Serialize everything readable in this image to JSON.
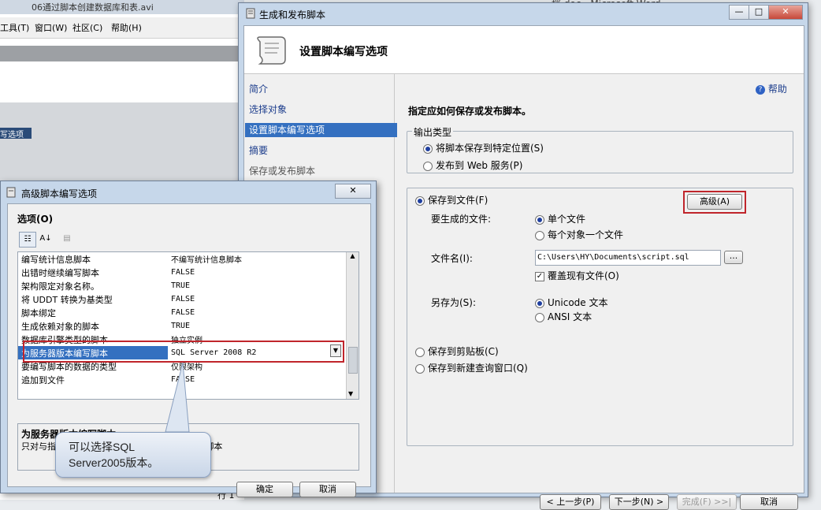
{
  "bg_app": {
    "title": "06通过脚本创建数据库和表.avi",
    "menus": [
      "工具(T)",
      "窗口(W)",
      "社区(C)",
      "帮助(H)"
    ],
    "section_header": "写选项",
    "right_title": "档.doc - Microsoft Word",
    "status_text": "行 1"
  },
  "main_window": {
    "title": "生成和发布脚本",
    "banner_title": "设置脚本编写选项",
    "help": "帮助",
    "nav": [
      "简介",
      "选择对象",
      "设置脚本编写选项",
      "摘要",
      "保存或发布脚本"
    ],
    "instruction": "指定应如何保存或发布脚本。",
    "output_type": {
      "label": "输出类型",
      "opt_save": "将脚本保存到特定位置(S)",
      "opt_web": "发布到 Web 服务(P)"
    },
    "save_to_file": "保存到文件(F)",
    "advanced_button": "高级(A)",
    "files_to_generate": "要生成的文件:",
    "single_file": "单个文件",
    "file_per_object": "每个对象一个文件",
    "file_name_label": "文件名(I):",
    "file_name_value": "C:\\Users\\HY\\Documents\\script.sql",
    "browse": "...",
    "overwrite": "覆盖现有文件(O)",
    "save_as_label": "另存为(S):",
    "unicode": "Unicode 文本",
    "ansi": "ANSI 文本",
    "clipboard": "保存到剪贴板(C)",
    "new_query": "保存到新建查询窗口(Q)",
    "buttons": {
      "prev": "< 上一步(P)",
      "next": "下一步(N) >",
      "finish": "完成(F) >>|",
      "cancel": "取消"
    }
  },
  "adv_dialog": {
    "title": "高级脚本编写选项",
    "options_label": "选项(O)",
    "rows": [
      {
        "name": "编写统计信息脚本",
        "value": "不编写统计信息脚本"
      },
      {
        "name": "出错时继续编写脚本",
        "value": "FALSE"
      },
      {
        "name": "架构限定对象名称。",
        "value": "TRUE"
      },
      {
        "name": "将 UDDT 转换为基类型",
        "value": "FALSE"
      },
      {
        "name": "脚本绑定",
        "value": "FALSE"
      },
      {
        "name": "生成依赖对象的脚本",
        "value": "TRUE"
      },
      {
        "name": "数据库引擎类型的脚本",
        "value": "独立实例"
      },
      {
        "name": "为服务器版本编写脚本",
        "value": "SQL Server 2008 R2"
      },
      {
        "name": "要编写脚本的数据的类型",
        "value": "仅限架构"
      },
      {
        "name": "追加到文件",
        "value": "FALSE"
      }
    ],
    "desc_title": "为服务器版本编写脚本",
    "desc_text": "只对与指定版本的 SQL Server 兼容的功能编写脚本",
    "ok": "确定",
    "cancel": "取消"
  },
  "callout": {
    "line1": "可以选择SQL",
    "line2": "Server2005版本。"
  }
}
